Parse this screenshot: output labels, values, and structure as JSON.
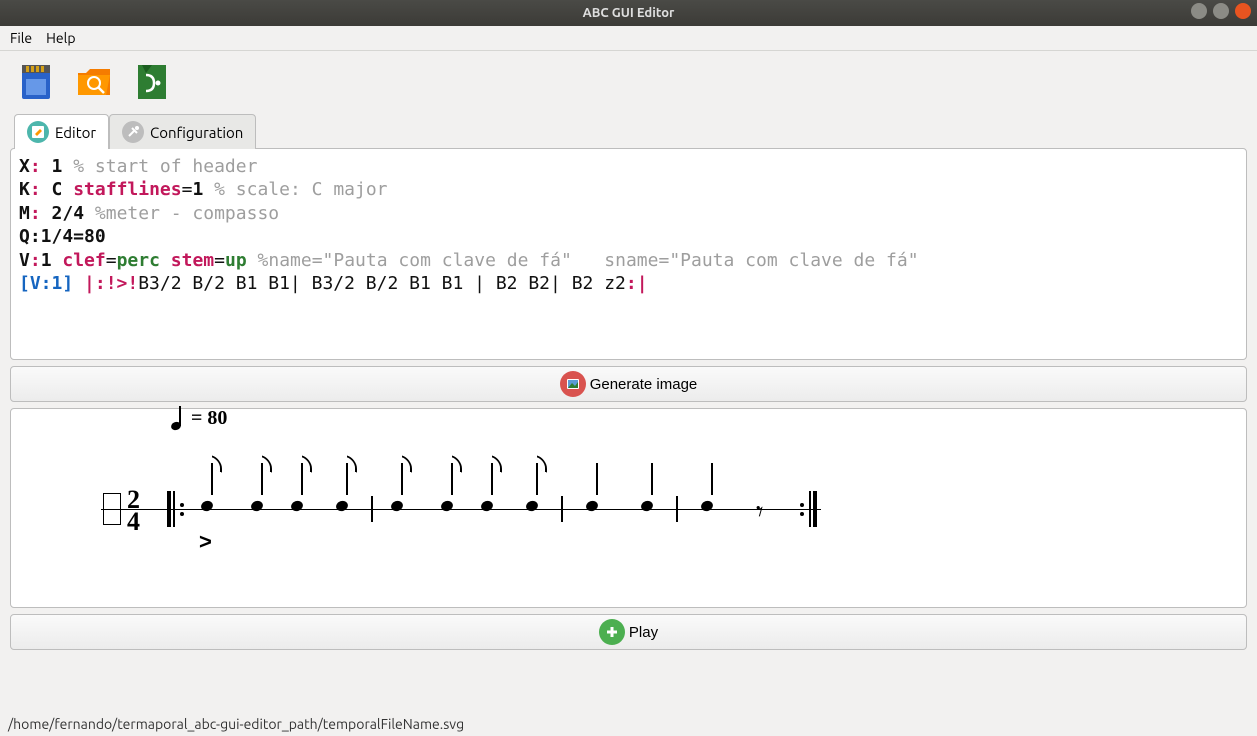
{
  "window": {
    "title": "ABC GUI Editor"
  },
  "menu": {
    "file": "File",
    "help": "Help"
  },
  "toolbar": {
    "save_icon": "sd-card-icon",
    "open_icon": "folder-search-icon",
    "export_icon": "export-bracket-icon"
  },
  "tabs": {
    "editor": "Editor",
    "config": "Configuration"
  },
  "editor_code": {
    "l1_key": "X",
    "l1_val": "1",
    "l1_com": "% start of header",
    "l2_key": "K",
    "l2_val": "C",
    "l2_attr": "stafflines",
    "l2_attr_val": "1",
    "l2_com": "% scale: C major",
    "l3_key": "M",
    "l3_val": "2/4",
    "l3_com": "%meter - compasso",
    "l4": "Q:1/4=80",
    "l5_key": "V",
    "l5_val": "1",
    "l5_a1": "clef",
    "l5_a1v": "perc",
    "l5_a2": "stem",
    "l5_a2v": "up",
    "l5_com": "%name=\"Pauta com clave de fá\"   sname=\"Pauta com clave de fá\"",
    "l6_voice": "[V:1]",
    "l6_start": "|:!>!",
    "l6_body": "B3/2 B/2 B1 B1| B3/2 B/2 B1 B1 | B2 B2| B2 z2",
    "l6_end": ":|"
  },
  "buttons": {
    "generate": "Generate image",
    "play": "Play"
  },
  "score": {
    "tempo_label": " = 80",
    "time_top": "2",
    "time_bot": "4",
    "accent": ">"
  },
  "statusbar": "/home/fernando/termaporal_abc-gui-editor_path/temporalFileName.svg"
}
